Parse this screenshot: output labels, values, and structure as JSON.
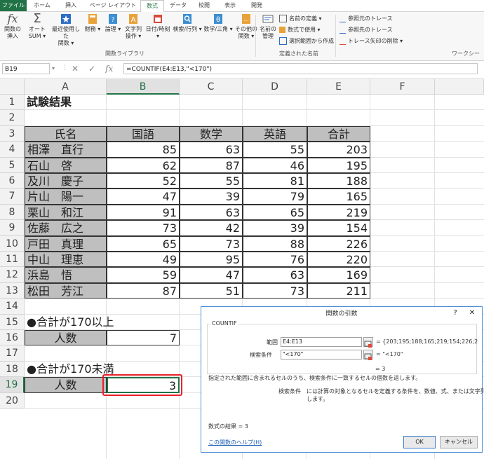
{
  "ribbon_tabs": [
    "ファイル",
    "ホーム",
    "挿入",
    "ページ レイアウト",
    "数式",
    "データ",
    "校閲",
    "表示",
    "開発"
  ],
  "ribbon": {
    "insert_function": [
      "関数の",
      "挿入"
    ],
    "autosum": [
      "オート",
      "SUM ▾"
    ],
    "recent": [
      "最近使用した",
      "関数 ▾"
    ],
    "financial": "財務",
    "logical": "論理",
    "text": [
      "文字列",
      "操作 ▾"
    ],
    "datetime": "日付/時刻",
    "lookup": "検索/行列",
    "math": "数学/三角",
    "more": [
      "その他の",
      "関数 ▾"
    ],
    "group_library": "関数ライブラリ",
    "name_manager": [
      "名前の",
      "管理"
    ],
    "define_name": "名前の定義 ▾",
    "use_in_formula": "数式で使用 ▾",
    "create_from_selection": "選択範囲から作成",
    "group_defined_names": "定義された名前",
    "trace_precedents": "参照元のトレース",
    "trace_dependents": "参照先のトレース",
    "remove_arrows": "トレース矢印の削除 ▾",
    "group_auditing": "ワークシー"
  },
  "formula_bar": {
    "name_box": "B19",
    "formula": "=COUNTIF(E4:E13,\"<170\")"
  },
  "columns": [
    "A",
    "B",
    "C",
    "D",
    "E",
    "F"
  ],
  "rows": [
    "1",
    "2",
    "3",
    "4",
    "5",
    "6",
    "7",
    "8",
    "9",
    "10",
    "11",
    "12",
    "13",
    "14",
    "15",
    "16",
    "17",
    "18",
    "19",
    "20"
  ],
  "sheet": {
    "title": "試験結果",
    "headers": [
      "氏名",
      "国語",
      "数学",
      "英語",
      "合計"
    ],
    "data": [
      [
        "相澤　直行",
        "85",
        "63",
        "55",
        "203"
      ],
      [
        "石山　啓",
        "62",
        "87",
        "46",
        "195"
      ],
      [
        "及川　慶子",
        "52",
        "55",
        "81",
        "188"
      ],
      [
        "片山　陽一",
        "47",
        "39",
        "79",
        "165"
      ],
      [
        "栗山　和江",
        "91",
        "63",
        "65",
        "219"
      ],
      [
        "佐藤　広之",
        "73",
        "42",
        "39",
        "154"
      ],
      [
        "戸田　真理",
        "65",
        "73",
        "88",
        "226"
      ],
      [
        "中山　理恵",
        "49",
        "95",
        "76",
        "220"
      ],
      [
        "浜島　悟",
        "59",
        "47",
        "63",
        "169"
      ],
      [
        "松田　芳江",
        "87",
        "51",
        "73",
        "211"
      ]
    ],
    "section1_title": "●合計が170以上",
    "section1_label": "人数",
    "section1_value": "7",
    "section2_title": "●合計が170未満",
    "section2_label": "人数",
    "section2_value": "3"
  },
  "dialog": {
    "title": "関数の引数",
    "help_btn": "?",
    "close_btn": "✕",
    "function_name": "COUNTIF",
    "arg1_label": "範囲",
    "arg1_value": "E4:E13",
    "arg1_result": "= {203;195;188;165;219;154;226;2",
    "arg2_label": "検索条件",
    "arg2_value": "\"<170\"",
    "arg2_result": "= \"<170\"",
    "result_line": "= 3",
    "description": "指定された範囲に含まれるセルのうち、検索条件に一致するセルの個数を返します。",
    "param_name": "検索条件",
    "param_desc_1": "には計算の対象となるセルを定義する条件を、数値、式、または文字列で指定",
    "param_desc_2": "します。",
    "formula_result": "数式の結果 =  3",
    "help_link": "この関数のヘルプ(H)",
    "ok": "OK",
    "cancel": "キャンセル"
  },
  "colors": {
    "excel_green": "#217346",
    "header_fill": "#bfbfbf",
    "highlight_red": "#e8202a"
  }
}
